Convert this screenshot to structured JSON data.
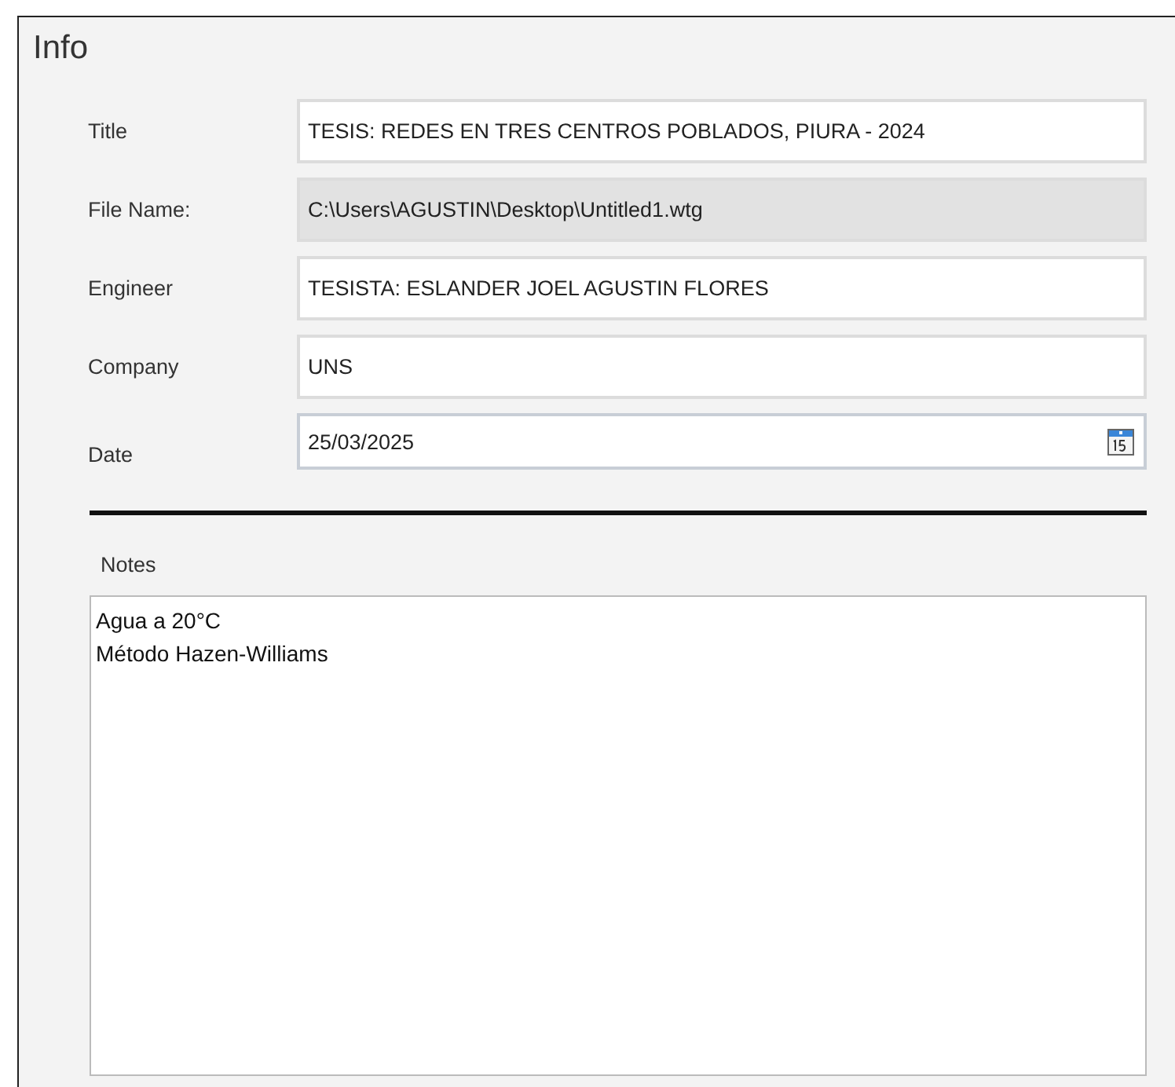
{
  "panel": {
    "title": "Info"
  },
  "fields": [
    {
      "label": "Title",
      "value": "TESIS: REDES EN TRES CENTROS POBLADOS, PIURA - 2024",
      "kind": "text",
      "disabled": false
    },
    {
      "label": "File Name:",
      "value": "C:\\Users\\AGUSTIN\\Desktop\\Untitled1.wtg",
      "kind": "text",
      "disabled": true
    },
    {
      "label": "Engineer",
      "value": "TESISTA: ESLANDER JOEL AGUSTIN FLORES",
      "kind": "text",
      "disabled": false
    },
    {
      "label": "Company",
      "value": "UNS",
      "kind": "text",
      "disabled": false
    },
    {
      "label": "Date",
      "value": "25/03/2025",
      "kind": "date",
      "disabled": false
    }
  ],
  "notes": {
    "label": "Notes",
    "lines": [
      "Agua a 20°C",
      "Método Hazen-Williams"
    ]
  }
}
